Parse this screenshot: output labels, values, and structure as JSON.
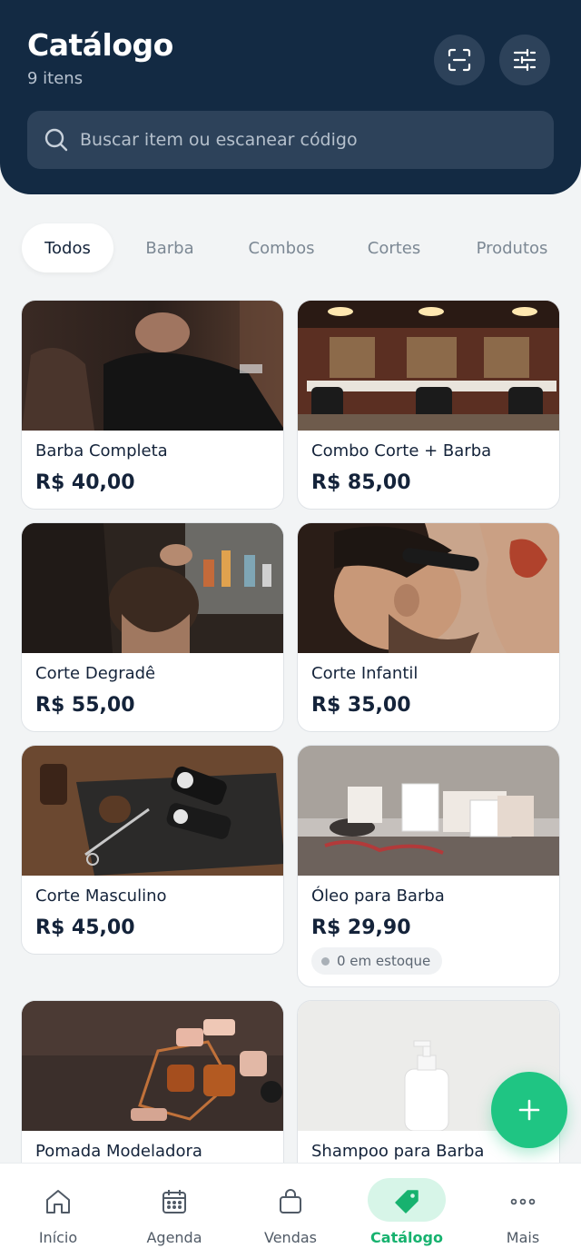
{
  "header": {
    "title": "Catálogo",
    "count_label": "9 itens",
    "scan_icon": "scan-barcode-icon",
    "filter_icon": "sliders-icon"
  },
  "search": {
    "placeholder": "Buscar item ou escanear código"
  },
  "tabs": [
    {
      "label": "Todos",
      "active": true
    },
    {
      "label": "Barba"
    },
    {
      "label": "Combos"
    },
    {
      "label": "Cortes"
    },
    {
      "label": "Produtos"
    }
  ],
  "items": [
    {
      "name": "Barba Completa",
      "price": "R$ 40,00"
    },
    {
      "name": "Combo Corte + Barba",
      "price": "R$ 85,00"
    },
    {
      "name": "Corte Degradê",
      "price": "R$ 55,00"
    },
    {
      "name": "Corte Infantil",
      "price": "R$ 35,00"
    },
    {
      "name": "Corte Masculino",
      "price": "R$ 45,00"
    },
    {
      "name": "Óleo para Barba",
      "price": "R$ 29,90",
      "stock": "0 em estoque"
    },
    {
      "name": "Pomada Modeladora"
    },
    {
      "name": "Shampoo para Barba"
    }
  ],
  "fab": {
    "icon": "plus-icon"
  },
  "nav": [
    {
      "label": "Início",
      "icon": "home-icon"
    },
    {
      "label": "Agenda",
      "icon": "calendar-icon"
    },
    {
      "label": "Vendas",
      "icon": "shopping-bag-icon"
    },
    {
      "label": "Catálogo",
      "icon": "tag-icon",
      "active": true
    },
    {
      "label": "Mais",
      "icon": "more-dots-icon"
    }
  ],
  "colors": {
    "header_bg": "#132a43",
    "accent_green": "#1fc583",
    "page_bg": "#f2f4f5"
  }
}
